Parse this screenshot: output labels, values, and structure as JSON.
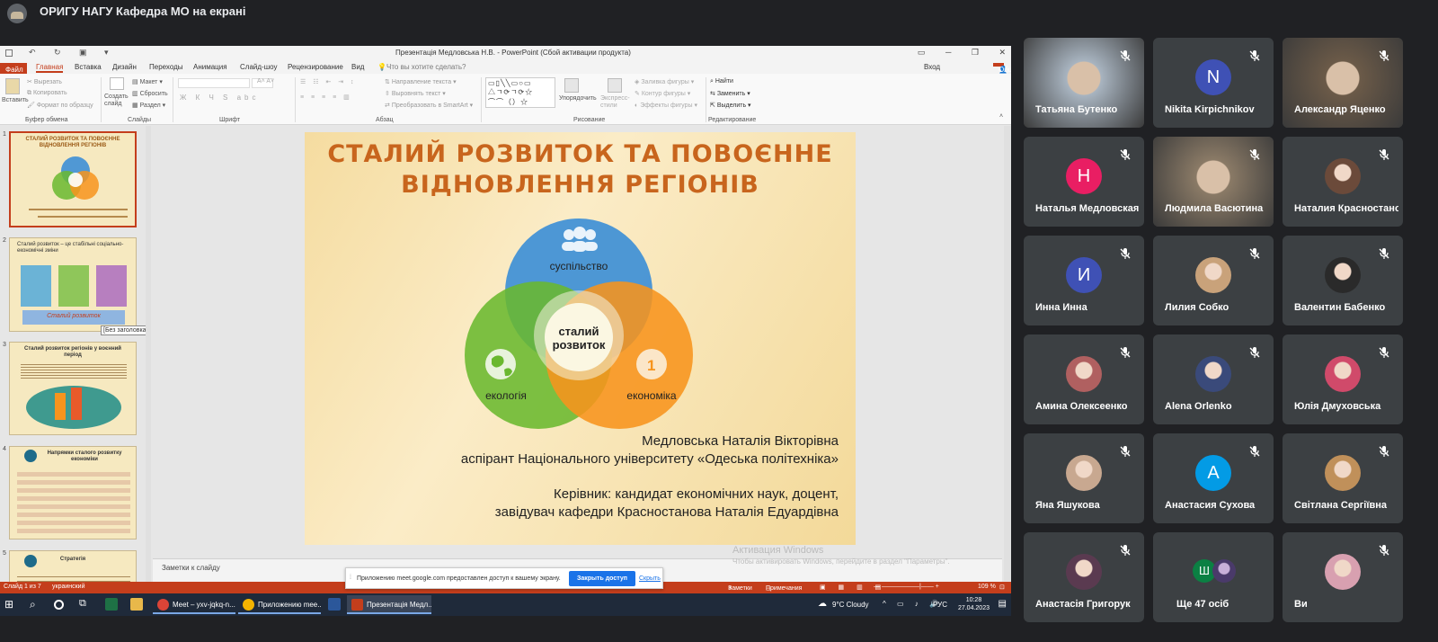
{
  "meeting": {
    "title": "ОРИГУ НАГУ Кафедра МО на екрані"
  },
  "powerpoint": {
    "window_title": "Презентація Медловська Н.В. - PowerPoint (Сбой активации продукта)",
    "tabs": [
      "Файл",
      "Главная",
      "Вставка",
      "Дизайн",
      "Переходы",
      "Анимация",
      "Слайд-шоу",
      "Рецензирование",
      "Вид"
    ],
    "tell_me": "Что вы хотите сделать?",
    "signin": "Вход",
    "share": "Общий доступ",
    "ribbon": {
      "paste": "Вставить",
      "cut": "Вырезать",
      "copy": "Копировать",
      "format_painter": "Формат по образцу",
      "new_slide": "Создать слайд",
      "layout": "Макет",
      "reset": "Сбросить",
      "section": "Раздел",
      "text_direction": "Направление текста",
      "align_text": "Выровнять текст",
      "convert_smartart": "Преобразовать в SmartArt",
      "arrange": "Упорядочить",
      "quick_styles": "Экспресс-стили",
      "shape_fill": "Заливка фигуры",
      "shape_outline": "Контур фигуры",
      "shape_effects": "Эффекты фигуры",
      "find": "Найти",
      "replace": "Заменить",
      "select": "Выделить",
      "groups": {
        "clipboard": "Буфер обмена",
        "slides": "Слайды",
        "font": "Шрифт",
        "paragraph": "Абзац",
        "drawing": "Рисование",
        "editing": "Редактирование"
      }
    },
    "thumbnails": [
      {
        "num": "1",
        "title": "СТАЛИЙ РОЗВИТОК ТА ПОВОЄННЕ ВІДНОВЛЕННЯ РЕГІОНІВ"
      },
      {
        "num": "2",
        "title": "Сталий розвиток – це стабільні соціально-економічні зміни",
        "caption": "Сталий розвиток"
      },
      {
        "num": "3",
        "title": "Сталий розвиток регіонів у воєнний період"
      },
      {
        "num": "4",
        "title": "Напрямки сталого розвитку економіки"
      },
      {
        "num": "5",
        "title": "Стратегія"
      }
    ],
    "tooltip": "[Без заголовка]",
    "slide": {
      "title_line1": "СТАЛИЙ РОЗВИТОК ТА ПОВОЄННЕ",
      "title_line2": "ВІДНОВЛЕННЯ РЕГІОНІВ",
      "diagram": {
        "top": "суспільство",
        "center_line1": "сталий",
        "center_line2": "розвиток",
        "left": "екологія",
        "right": "економіка",
        "colors": {
          "top": "#3e8fd6",
          "left": "#6ab82f",
          "right": "#f7941d"
        }
      },
      "author_line1": "Медловська Наталія Вікторівна",
      "author_line2": "аспірант Національного університету «Одеська політехніка»",
      "supervisor_line1": "Керівник: кандидат економічних наук, доцент,",
      "supervisor_line2": "завідувач кафедри Красностанова Наталія Едуардівна"
    },
    "notes_placeholder": "Заметки к слайду",
    "activation_title": "Активация Windows",
    "activation_text": "Чтобы активировать Windows, перейдите в раздел \"Параметры\".",
    "status": {
      "slide_counter": "Слайд 1 из 7",
      "language": "украинский",
      "notes": "Заметки",
      "comments": "Примечания",
      "zoom": "109 %"
    }
  },
  "share_popup": {
    "text": "Приложению meet.google.com предоставлен доступ к вашему экрану.",
    "stop": "Закрыть доступ",
    "hide": "Скрыть"
  },
  "taskbar": {
    "apps": [
      "Meet – yxv-jqkq-n...",
      "Приложению mee...",
      "Презентація Медл..."
    ],
    "weather": "9°C  Cloudy",
    "lang": "РУС",
    "time": "10:28",
    "date": "27.04.2023"
  },
  "participants": [
    {
      "name": "Татьяна Бутенко",
      "type": "video",
      "color": "#a8b4c0"
    },
    {
      "name": "Nikita Kirpichnikov",
      "type": "letter",
      "letter": "N",
      "color": "#3f51b5"
    },
    {
      "name": "Александр Яценко",
      "type": "video",
      "color": "#6b5a48"
    },
    {
      "name": "Наталья Медловская",
      "type": "letter",
      "letter": "Н",
      "color": "#e91e63"
    },
    {
      "name": "Людмила Васютина",
      "type": "video",
      "color": "#8a7a66"
    },
    {
      "name": "Наталия Красностанова",
      "type": "photo",
      "color": "#6b4a3a"
    },
    {
      "name": "Инна Инна",
      "type": "letter",
      "letter": "И",
      "color": "#3f51b5"
    },
    {
      "name": "Лилия Собко",
      "type": "photo",
      "color": "#c9a27a"
    },
    {
      "name": "Валентин Бабенко",
      "type": "photo",
      "color": "#2a2a2a"
    },
    {
      "name": "Амина Олексеенко",
      "type": "photo",
      "color": "#b06060"
    },
    {
      "name": "Alena Orlenko",
      "type": "photo",
      "color": "#3a4a7a"
    },
    {
      "name": "Юлія Дмуховська",
      "type": "photo",
      "color": "#d04a6a"
    },
    {
      "name": "Яна Яшукова",
      "type": "photo",
      "color": "#c8a890"
    },
    {
      "name": "Анастасия Сухова",
      "type": "letter",
      "letter": "А",
      "color": "#039be5"
    },
    {
      "name": "Світлана Сергіївна",
      "type": "photo",
      "color": "#c0905a"
    },
    {
      "name": "Анастасія Григорук",
      "type": "photo",
      "color": "#5a3a50"
    },
    {
      "name": "Ще 47 осіб",
      "type": "more",
      "letter": "Ш",
      "color": "#0b8043"
    },
    {
      "name": "Ви",
      "type": "photo",
      "color": "#d8a0b0"
    }
  ]
}
